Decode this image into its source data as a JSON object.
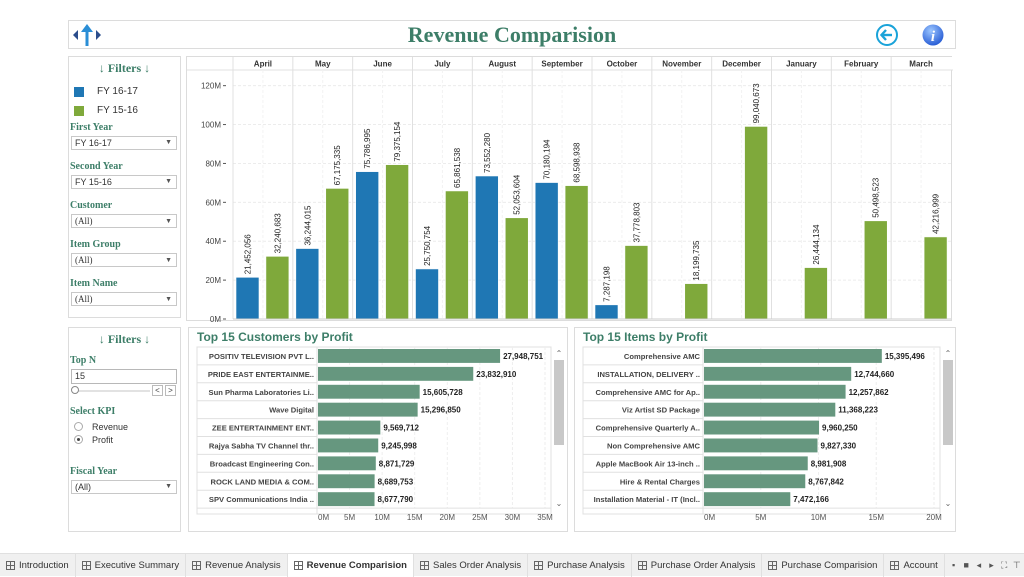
{
  "header": {
    "title": "Revenue Comparision",
    "back_icon": "back-arrow-icon",
    "info_icon": "info-icon",
    "logo_icon": "logo-arrows-icon"
  },
  "filters_top": {
    "title": "↓ Filters ↓",
    "legend": [
      {
        "label": "FY 16-17",
        "color": "#1f77b4"
      },
      {
        "label": "FY 15-16",
        "color": "#7fa93b"
      }
    ],
    "first_year": {
      "label": "First Year",
      "value": "FY 16-17"
    },
    "second_year": {
      "label": "Second Year",
      "value": "FY 15-16"
    },
    "customer": {
      "label": "Customer",
      "value": "(All)"
    },
    "item_group": {
      "label": "Item Group",
      "value": "(All)"
    },
    "item_name": {
      "label": "Item Name",
      "value": "(All)"
    }
  },
  "filters_bottom": {
    "title": "↓ Filters ↓",
    "top_n": {
      "label": "Top N",
      "value": "15",
      "prev": "<",
      "next": ">"
    },
    "select_kpi": {
      "label": "Select KPI",
      "options": [
        "Revenue",
        "Profit"
      ],
      "selected": "Profit"
    },
    "fiscal_year": {
      "label": "Fiscal Year",
      "value": "(All)"
    }
  },
  "chart_data": [
    {
      "type": "bar",
      "title": "Revenue Comparision",
      "categories": [
        "April",
        "May",
        "June",
        "July",
        "August",
        "September",
        "October",
        "November",
        "December",
        "January",
        "February",
        "March"
      ],
      "series": [
        {
          "name": "FY 16-17",
          "color": "#1f77b4",
          "values": [
            21452056,
            36244015,
            75786995,
            25750754,
            73552280,
            70180194,
            7287198,
            null,
            null,
            null,
            null,
            null
          ],
          "labels": [
            "21,452,056",
            "36,244,015",
            "75,786,995",
            "25,750,754",
            "73,552,280",
            "70,180,194",
            "7,287,198",
            "",
            "",
            "",
            "",
            ""
          ]
        },
        {
          "name": "FY 15-16",
          "color": "#7fa93b",
          "values": [
            32240683,
            67175335,
            79375154,
            65861538,
            52053604,
            68598938,
            37778803,
            18199735,
            99040673,
            26444134,
            50498523,
            42216999
          ],
          "labels": [
            "32,240,683",
            "67,175,335",
            "79,375,154",
            "65,861,538",
            "52,053,604",
            "68,598,938",
            "37,778,803",
            "18,199,735",
            "99,040,673",
            "26,444,134",
            "50,498,523",
            "42,216,999"
          ]
        }
      ],
      "yticks": [
        "0M",
        "20M",
        "40M",
        "60M",
        "80M",
        "100M",
        "120M"
      ],
      "ylim": [
        0,
        126000000
      ],
      "grid": true,
      "legend": "left-panel"
    },
    {
      "type": "bar",
      "orientation": "horizontal",
      "title": "Top 15 Customers by Profit",
      "categories": [
        "POSITIV TELEVISION PVT L..",
        "PRIDE EAST ENTERTAINME..",
        "Sun Pharma Laboratories Li..",
        "Wave Digital",
        "ZEE ENTERTAINMENT ENT..",
        "Rajya Sabha TV Channel thr..",
        "Broadcast Engineering Con..",
        "ROCK LAND MEDIA & COM..",
        "SPV Communications India .."
      ],
      "values": [
        27948751,
        23832910,
        15605728,
        15296850,
        9569712,
        9245998,
        8871729,
        8689753,
        8677790
      ],
      "labels": [
        "27,948,751",
        "23,832,910",
        "15,605,728",
        "15,296,850",
        "9,569,712",
        "9,245,998",
        "8,871,729",
        "8,689,753",
        "8,677,790"
      ],
      "xticks": [
        "0M",
        "5M",
        "10M",
        "15M",
        "20M",
        "25M",
        "30M",
        "35M"
      ],
      "xlim": [
        0,
        35000000
      ],
      "color": "#66977f"
    },
    {
      "type": "bar",
      "orientation": "horizontal",
      "title": "Top 15 Items by Profit",
      "categories": [
        "Comprehensive AMC",
        "INSTALLATION, DELIVERY ..",
        "Comprehensive AMC for Ap..",
        "Viz Artist SD Package",
        "Comprehensive Quarterly  A..",
        "Non Comprehensive AMC",
        "Apple MacBook Air 13-inch ..",
        "Hire & Rental Charges",
        "Installation Material - IT (Incl.."
      ],
      "values": [
        15395496,
        12744660,
        12257862,
        11368223,
        9960250,
        9827330,
        8981908,
        8767842,
        7472166
      ],
      "labels": [
        "15,395,496",
        "12,744,660",
        "12,257,862",
        "11,368,223",
        "9,960,250",
        "9,827,330",
        "8,981,908",
        "8,767,842",
        "7,472,166"
      ],
      "xticks": [
        "0M",
        "5M",
        "10M",
        "15M",
        "20M"
      ],
      "xlim": [
        0,
        20000000
      ],
      "color": "#66977f"
    }
  ],
  "tabs": [
    {
      "label": "Introduction",
      "active": false
    },
    {
      "label": "Executive Summary",
      "active": false
    },
    {
      "label": "Revenue Analysis",
      "active": false
    },
    {
      "label": "Revenue Comparision",
      "active": true
    },
    {
      "label": "Sales Order Analysis",
      "active": false
    },
    {
      "label": "Purchase Analysis",
      "active": false
    },
    {
      "label": "Purchase Order Analysis",
      "active": false
    },
    {
      "label": "Purchase Comparision",
      "active": false
    },
    {
      "label": "Account",
      "active": false
    }
  ],
  "tab_controls": [
    {
      "icon": "filmstrip-icon",
      "glyph": "▪"
    },
    {
      "icon": "thumbnail-icon",
      "glyph": "■"
    },
    {
      "icon": "scroll-left-icon",
      "glyph": "◂"
    },
    {
      "icon": "scroll-right-icon",
      "glyph": "▸"
    },
    {
      "icon": "fullscreen-icon",
      "glyph": "⛶"
    },
    {
      "icon": "presentation-icon",
      "glyph": "⊤"
    }
  ]
}
